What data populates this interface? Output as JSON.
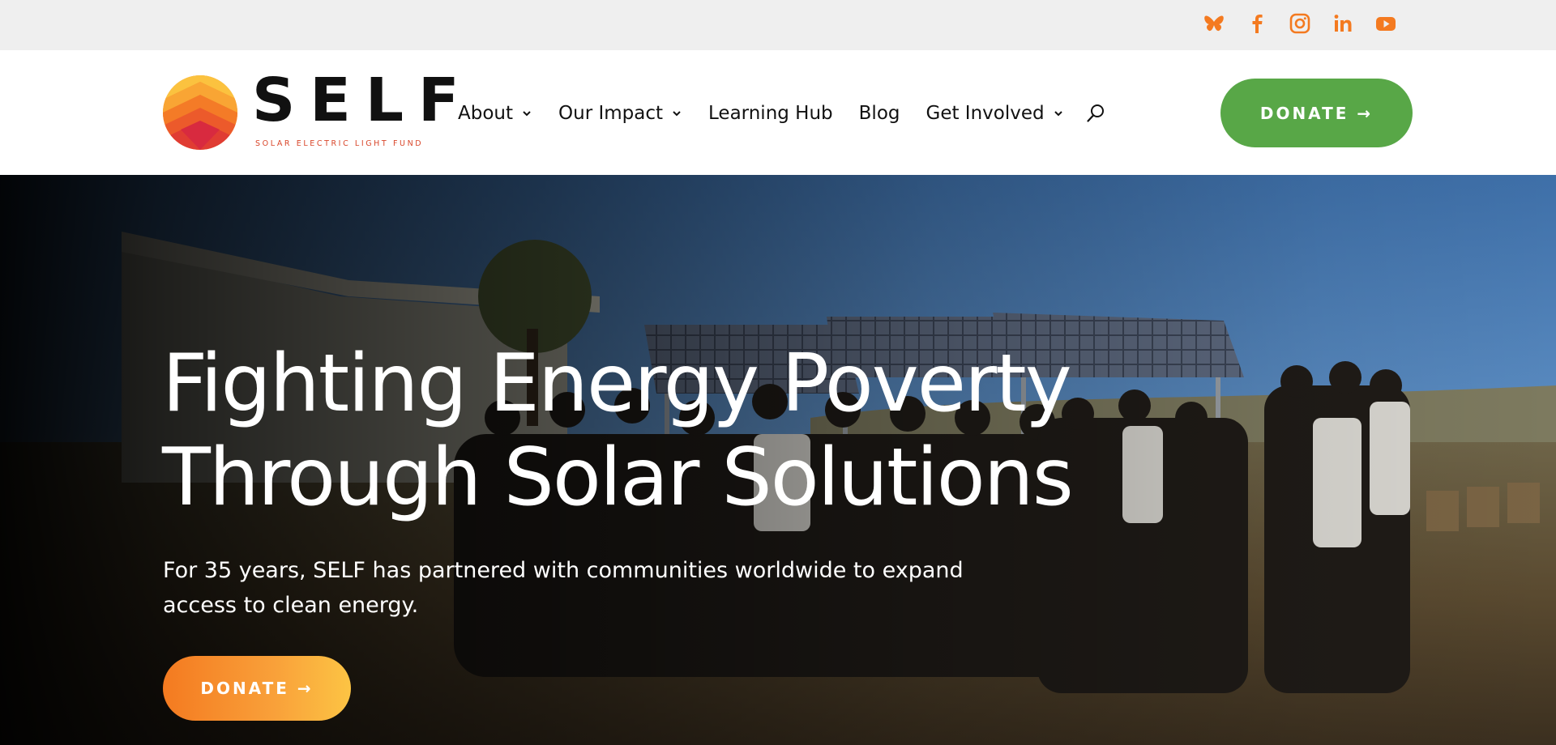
{
  "social": {
    "items": [
      {
        "name": "bluesky",
        "icon": "butterfly-icon"
      },
      {
        "name": "facebook",
        "icon": "facebook-icon"
      },
      {
        "name": "instagram",
        "icon": "instagram-icon"
      },
      {
        "name": "linkedin",
        "icon": "linkedin-icon"
      },
      {
        "name": "youtube",
        "icon": "youtube-icon"
      }
    ],
    "color": "#f47a20"
  },
  "brand": {
    "wordmark": "SELF",
    "tagline": "SOLAR ELECTRIC LIGHT FUND"
  },
  "nav": {
    "items": [
      {
        "label": "About",
        "has_dropdown": true
      },
      {
        "label": "Our Impact",
        "has_dropdown": true
      },
      {
        "label": "Learning Hub",
        "has_dropdown": false
      },
      {
        "label": "Blog",
        "has_dropdown": false
      },
      {
        "label": "Get Involved",
        "has_dropdown": true
      }
    ],
    "search_icon": "search-icon"
  },
  "header": {
    "donate_label": "DONATE →",
    "donate_color": "#58a747"
  },
  "hero": {
    "title_line1": "Fighting Energy Poverty",
    "title_line2": "Through Solar Solutions",
    "subtitle": "For 35 years, SELF has partnered with communities worldwide to expand access to clean energy.",
    "donate_label": "DONATE →",
    "donate_gradient": [
      "#f47a20",
      "#fcc444"
    ]
  }
}
